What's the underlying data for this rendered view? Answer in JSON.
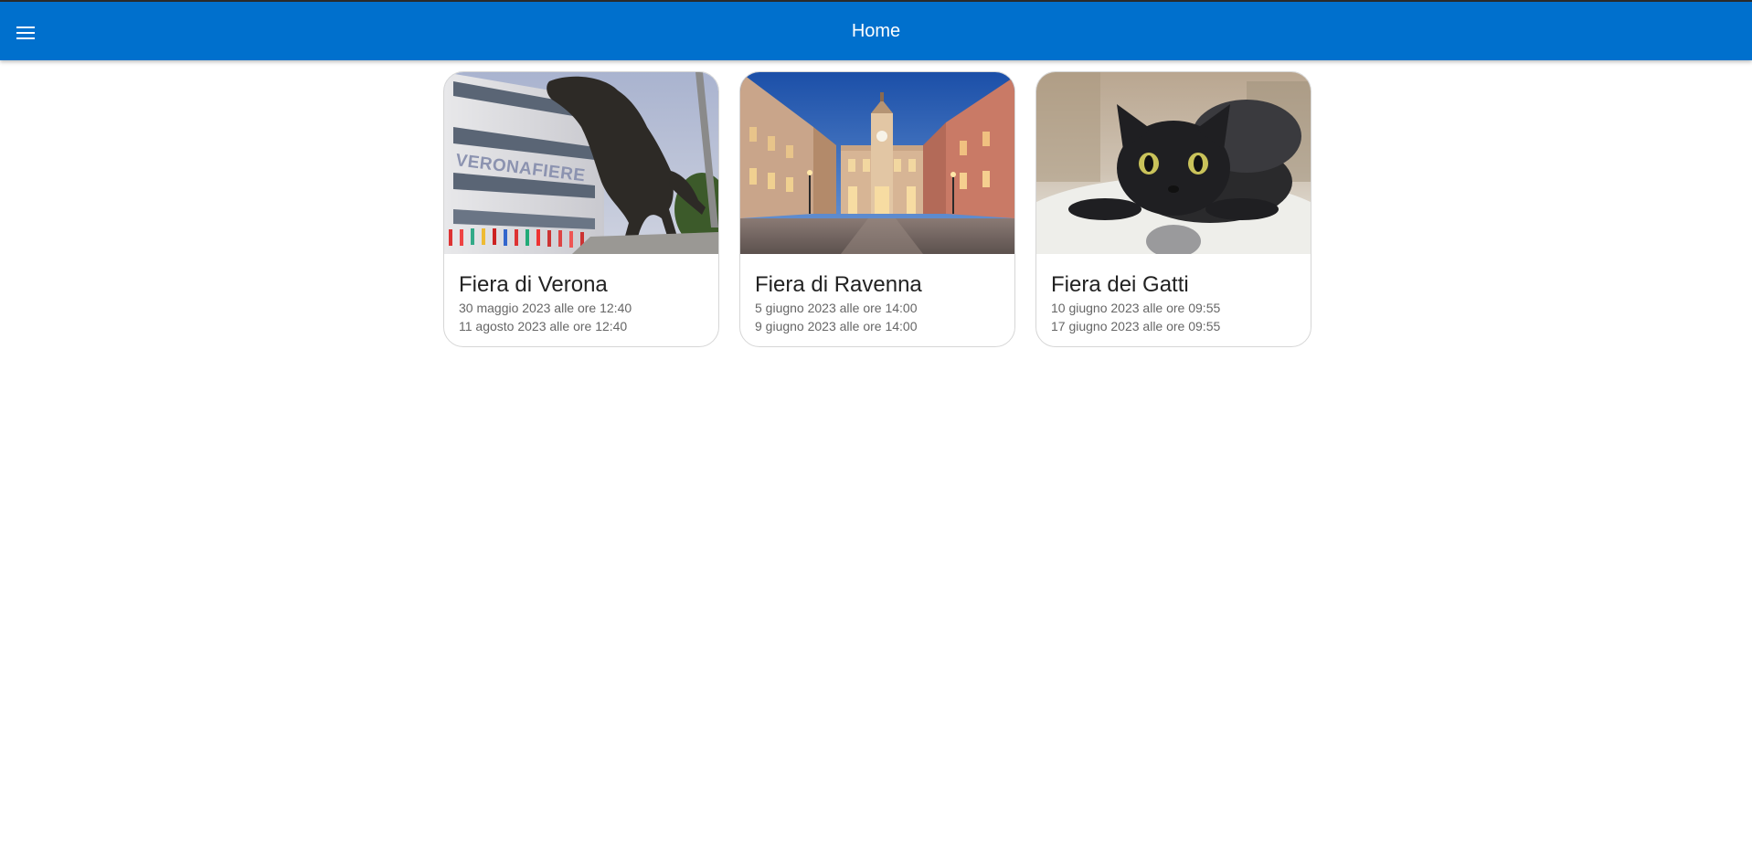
{
  "header": {
    "title": "Home",
    "menu_icon": "menu-icon",
    "background_color": "#0070cd"
  },
  "events": [
    {
      "title": "Fiera di Verona",
      "start": "30 maggio 2023 alle ore 12:40",
      "end": "11 agosto 2023 alle ore 12:40",
      "image_sign": "VERONAFIERE"
    },
    {
      "title": "Fiera di Ravenna",
      "start": "5 giugno 2023 alle ore 14:00",
      "end": "9 giugno 2023 alle ore 14:00"
    },
    {
      "title": "Fiera dei Gatti",
      "start": "10 giugno 2023 alle ore 09:55",
      "end": "17 giugno 2023 alle ore 09:55"
    }
  ]
}
